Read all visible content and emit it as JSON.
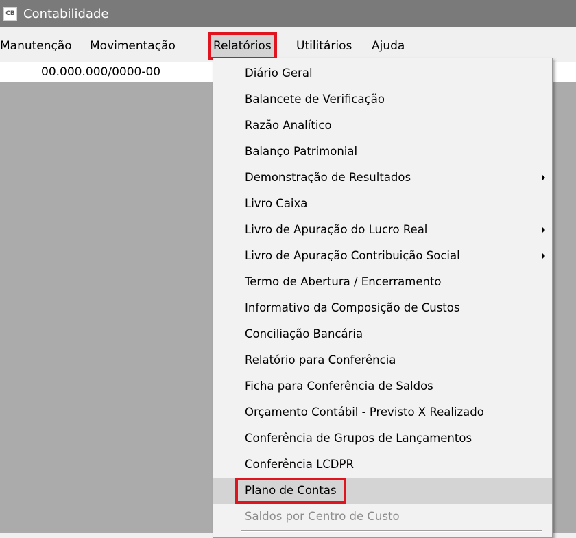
{
  "window": {
    "title": "Contabilidade",
    "icon_text": "CB"
  },
  "menubar": {
    "items": [
      {
        "label": "Manutenção"
      },
      {
        "label": "Movimentação"
      },
      {
        "label": "Relatórios"
      },
      {
        "label": "Utilitários"
      },
      {
        "label": "Ajuda"
      }
    ]
  },
  "company": {
    "cnpj": "00.000.000/0000-00"
  },
  "relatorios_menu": {
    "items": [
      {
        "label": "Diário Geral"
      },
      {
        "label": "Balancete de Verificação"
      },
      {
        "label": "Razão Analítico"
      },
      {
        "label": "Balanço Patrimonial"
      },
      {
        "label": "Demonstração de Resultados"
      },
      {
        "label": "Livro Caixa"
      },
      {
        "label": "Livro de Apuração do Lucro Real"
      },
      {
        "label": "Livro de Apuração Contribuição Social"
      },
      {
        "label": "Termo de Abertura / Encerramento"
      },
      {
        "label": "Informativo da Composição de Custos"
      },
      {
        "label": "Conciliação Bancária"
      },
      {
        "label": "Relatório para Conferência"
      },
      {
        "label": "Ficha para Conferência de Saldos"
      },
      {
        "label": "Orçamento Contábil - Previsto X Realizado"
      },
      {
        "label": "Conferência de Grupos de Lançamentos"
      },
      {
        "label": "Conferência LCDPR"
      },
      {
        "label": "Plano de Contas"
      },
      {
        "label": "Saldos por Centro de Custo"
      }
    ],
    "highlight_color": "#e0141e"
  }
}
